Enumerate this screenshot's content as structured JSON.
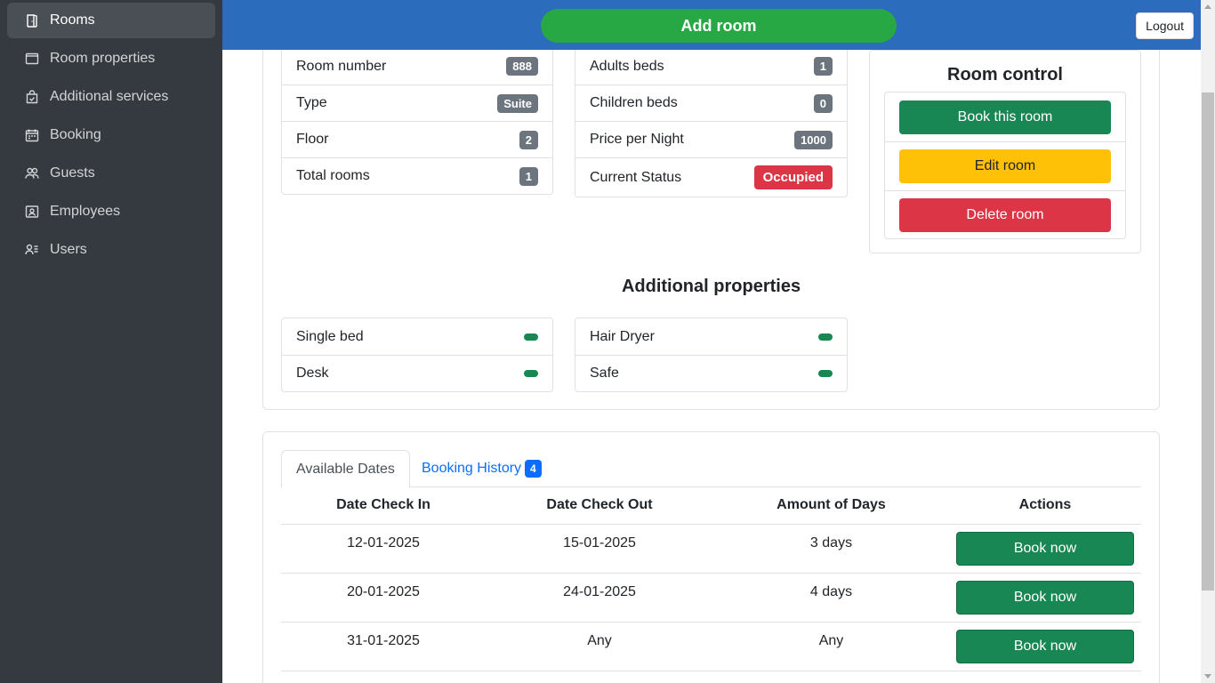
{
  "sidebar": {
    "items": [
      {
        "label": "Rooms",
        "icon": "door-icon"
      },
      {
        "label": "Room properties",
        "icon": "window-icon"
      },
      {
        "label": "Additional services",
        "icon": "bag-check-icon"
      },
      {
        "label": "Booking",
        "icon": "calendar-icon"
      },
      {
        "label": "Guests",
        "icon": "people-icon"
      },
      {
        "label": "Employees",
        "icon": "person-badge-icon"
      },
      {
        "label": "Users",
        "icon": "person-lines-icon"
      }
    ],
    "active_index": 0
  },
  "header": {
    "add_room_label": "Add room",
    "logout_label": "Logout"
  },
  "room_info": {
    "left": [
      {
        "label": "Room number",
        "value": "888"
      },
      {
        "label": "Type",
        "value": "Suite"
      },
      {
        "label": "Floor",
        "value": "2"
      },
      {
        "label": "Total rooms",
        "value": "1"
      }
    ],
    "right": [
      {
        "label": "Adults beds",
        "value": "1"
      },
      {
        "label": "Children beds",
        "value": "0"
      },
      {
        "label": "Price per Night",
        "value": "1000"
      },
      {
        "label": "Current Status",
        "value": "Occupied"
      }
    ]
  },
  "room_control": {
    "title": "Room control",
    "book_label": "Book this room",
    "edit_label": "Edit room",
    "delete_label": "Delete room"
  },
  "additional_properties": {
    "title": "Additional properties",
    "left": [
      "Single bed",
      "Desk"
    ],
    "right": [
      "Hair Dryer",
      "Safe"
    ]
  },
  "tabs": {
    "available_label": "Available Dates",
    "history_label": "Booking History",
    "history_count": "4"
  },
  "dates_table": {
    "headers": [
      "Date Check In",
      "Date Check Out",
      "Amount of Days",
      "Actions"
    ],
    "rows": [
      {
        "check_in": "12-01-2025",
        "check_out": "15-01-2025",
        "days": "3 days",
        "action": "Book now"
      },
      {
        "check_in": "20-01-2025",
        "check_out": "24-01-2025",
        "days": "4 days",
        "action": "Book now"
      },
      {
        "check_in": "31-01-2025",
        "check_out": "Any",
        "days": "Any",
        "action": "Book now"
      }
    ]
  },
  "colors": {
    "sidebar_bg": "#343a40",
    "header_bg": "#2c6cbd",
    "add_button": "#28a745",
    "success": "#198754",
    "warning": "#ffc107",
    "danger": "#dc3545",
    "primary": "#0d6efd"
  }
}
